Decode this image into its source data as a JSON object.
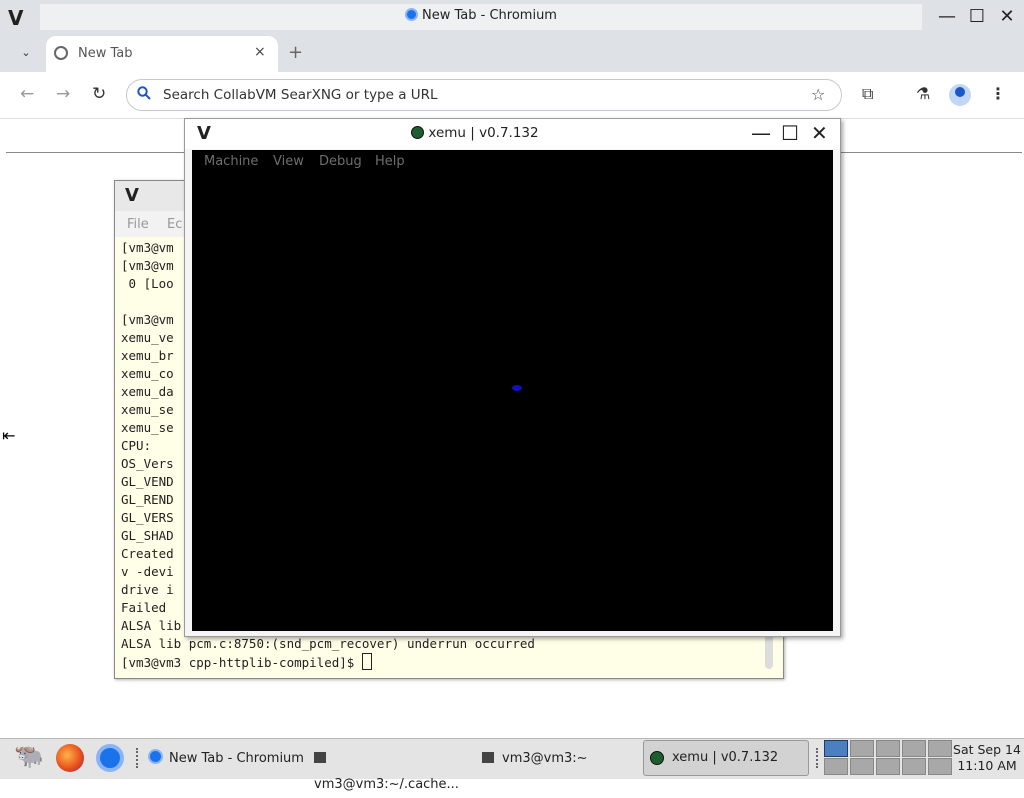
{
  "browser": {
    "window_title": "New Tab - Chromium",
    "tab_label": "New Tab",
    "tab_close": "×",
    "new_tab": "+",
    "omnibox_placeholder": "Search CollabVM SearXNG or type a URL",
    "logo": "V",
    "win_min": "—",
    "win_max": "☐",
    "win_close": "✕"
  },
  "terminal": {
    "logo": "V",
    "menu": [
      "File",
      "Ec"
    ],
    "lines": [
      "[vm3@vm",
      "[vm3@vm",
      " 0 [Loo",
      "",
      "[vm3@vm",
      "xemu_ve",
      "xemu_br",
      "xemu_co",
      "xemu_da",
      "xemu_se",
      "xemu_se",
      "CPU:",
      "OS_Vers",
      "GL_VEND",
      "GL_REND",
      "GL_VERS",
      "GL_SHAD",
      "Created",
      "v -devi",
      "drive i",
      "Failed ",
      "ALSA lib",
      "ALSA lib pcm.c:8750:(snd_pcm_recover) underrun occurred"
    ],
    "prompt": "[vm3@vm3 cpp-httplib-compiled]$ "
  },
  "xemu": {
    "logo": "V",
    "title": "xemu | v0.7.132",
    "menu": [
      "Machine",
      "View",
      "Debug",
      "Help"
    ],
    "win_min": "—",
    "win_max": "☐",
    "win_close": "✕"
  },
  "taskbar": {
    "items": [
      {
        "label": "New Tab - Chromium"
      },
      {
        "label": "vm3@vm3:~/.cache..."
      },
      {
        "label": "vm3@vm3:~"
      },
      {
        "label": "xemu | v0.7.132"
      }
    ],
    "clock_day": "Sat Sep 14",
    "clock_time": "11:10 AM"
  },
  "colors": {
    "terminal_bg": "#ffffe8",
    "screen_bg": "#000000",
    "accent": "#1a73e8"
  }
}
